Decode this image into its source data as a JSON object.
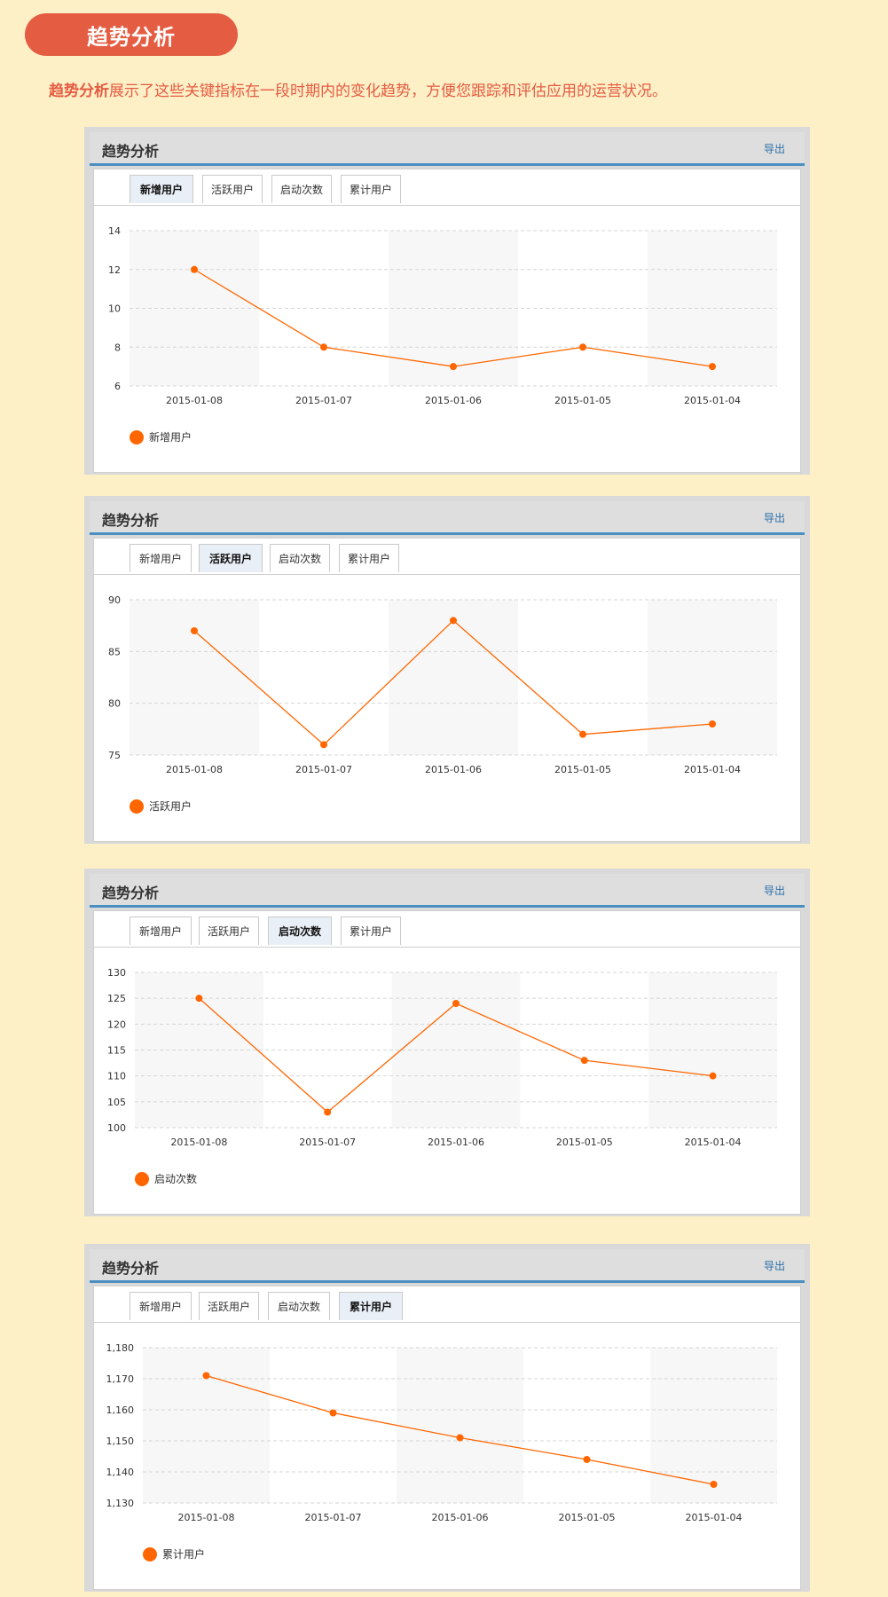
{
  "header": {
    "pill_title": "趋势分析",
    "intro_bold": "趋势分析",
    "intro_rest": "展示了这些关键指标在一段时期内的变化趋势，方便您跟踪和评估应用的运营状况。"
  },
  "panel_common": {
    "title": "趋势分析",
    "export_label": "导出",
    "tabs": [
      "新增用户",
      "活跃用户",
      "启动次数",
      "累计用户"
    ]
  },
  "colors": {
    "accent": "#e45c42",
    "line": "#ff6600",
    "background": "#fdefc6",
    "head_underline": "#4a8fc2"
  },
  "chart_data": [
    {
      "type": "line",
      "active_tab": 0,
      "categories": [
        "2015-01-08",
        "2015-01-07",
        "2015-01-06",
        "2015-01-05",
        "2015-01-04"
      ],
      "series": [
        {
          "name": "新增用户",
          "values": [
            12,
            8,
            7,
            8,
            7
          ]
        }
      ],
      "ylim": [
        6,
        14
      ],
      "yticks": [
        6,
        8,
        10,
        12,
        14
      ],
      "ytick_labels": [
        "6",
        "8",
        "10",
        "12",
        "14"
      ],
      "legend": "bottom-left",
      "grid": true
    },
    {
      "type": "line",
      "active_tab": 1,
      "categories": [
        "2015-01-08",
        "2015-01-07",
        "2015-01-06",
        "2015-01-05",
        "2015-01-04"
      ],
      "series": [
        {
          "name": "活跃用户",
          "values": [
            87,
            76,
            88,
            77,
            78
          ]
        }
      ],
      "ylim": [
        75,
        90
      ],
      "yticks": [
        75,
        80,
        85,
        90
      ],
      "ytick_labels": [
        "75",
        "80",
        "85",
        "90"
      ],
      "legend": "bottom-left",
      "grid": true
    },
    {
      "type": "line",
      "active_tab": 2,
      "categories": [
        "2015-01-08",
        "2015-01-07",
        "2015-01-06",
        "2015-01-05",
        "2015-01-04"
      ],
      "series": [
        {
          "name": "启动次数",
          "values": [
            125,
            103,
            124,
            113,
            110
          ]
        }
      ],
      "ylim": [
        100,
        130
      ],
      "yticks": [
        100,
        105,
        110,
        115,
        120,
        125,
        130
      ],
      "ytick_labels": [
        "100",
        "105",
        "110",
        "115",
        "120",
        "125",
        "130"
      ],
      "legend": "bottom-left",
      "grid": true
    },
    {
      "type": "line",
      "active_tab": 3,
      "categories": [
        "2015-01-08",
        "2015-01-07",
        "2015-01-06",
        "2015-01-05",
        "2015-01-04"
      ],
      "series": [
        {
          "name": "累计用户",
          "values": [
            1171,
            1159,
            1151,
            1144,
            1136
          ]
        }
      ],
      "ylim": [
        1130,
        1180
      ],
      "yticks": [
        1130,
        1140,
        1150,
        1160,
        1170,
        1180
      ],
      "ytick_labels": [
        "1,130",
        "1,140",
        "1,150",
        "1,160",
        "1,170",
        "1,180"
      ],
      "legend": "bottom-left",
      "grid": true
    }
  ]
}
